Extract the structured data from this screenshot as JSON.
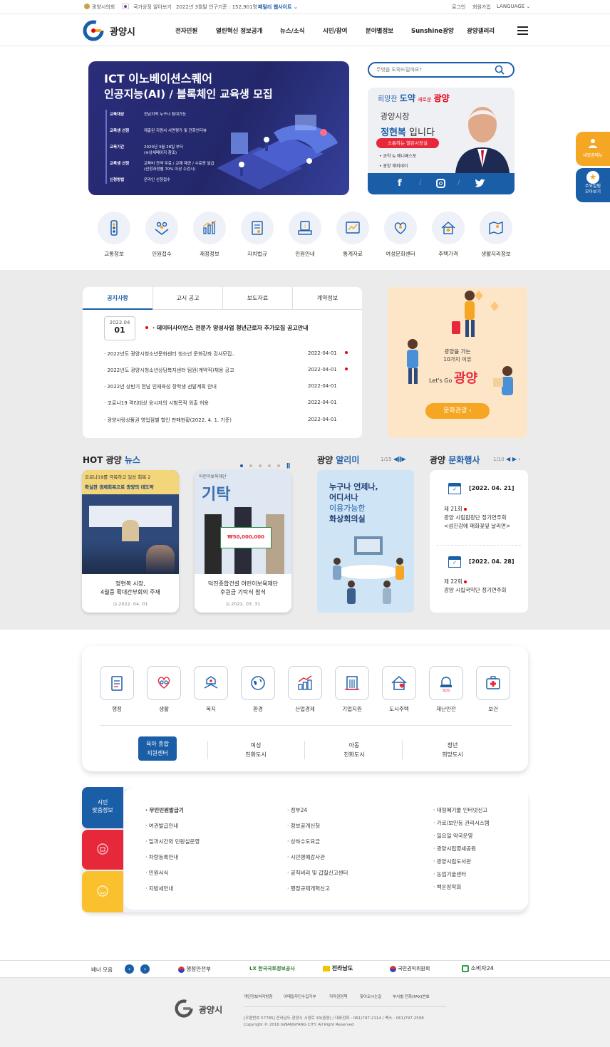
{
  "topbar": {
    "council": "광양시의회",
    "symbol": "국가상징 알아보기",
    "population": "2022년 3월말 인구기준 : 152,901명",
    "family_site": "패밀리 웹사이트",
    "login": "로그인",
    "join": "회원가입",
    "language": "LANGUAGE"
  },
  "header": {
    "logo_text": "광양시",
    "nav": [
      "전자민원",
      "열린혁신 정보공개",
      "뉴스/소식",
      "시민/참여",
      "분야별정보",
      "Sunshine광양",
      "광양갤러리"
    ]
  },
  "banner": {
    "title1": "ICT 이노베이션스퀘어",
    "title2": "인공지능(AI) / 블록체인 교육생 모집",
    "rows": [
      {
        "k": "교육대상",
        "v": "전남지역 누구나 참여가능"
      },
      {
        "k": "교육생 선정",
        "v": "제출된 지원서 서면평가 및 전화인터뷰"
      },
      {
        "k": "교육기간",
        "v": "2020년 3월 28일 부터",
        "v2": "(※상세페이지 참조)"
      },
      {
        "k": "교육생 선정",
        "v": "교육비 전액 무료 / 교재 제공 / 수료증 발급",
        "v2": "(선정과정별 70% 이상 수강시)"
      },
      {
        "k": "신청방법",
        "v": "온라인 신청접수"
      }
    ]
  },
  "search": {
    "placeholder": "무엇을 도와드릴까요?"
  },
  "mayor": {
    "slogan1": "희망찬",
    "slogan2": "도약",
    "slogan3": "새로운",
    "slogan4": "광양",
    "role": "광양시장",
    "name": "정현복",
    "suffix": "입니다",
    "badge": "소통하는 열린시장실",
    "link1": "• 공약 & 매니페스토",
    "link2": "• 광양 해피데이"
  },
  "quick": [
    "교통정보",
    "민원접수",
    "재정정보",
    "자치법규",
    "민원안내",
    "통계자료",
    "여성문화센터",
    "주택가격",
    "생활지리정보"
  ],
  "notice": {
    "tabs": [
      "공지사항",
      "고시 공고",
      "보도자료",
      "계약정보"
    ],
    "feature": {
      "ym": "2022.04",
      "day": "01",
      "title": "· 데이터사이언스 전문가 양성사업 청년근로자 추가모집 공고안내"
    },
    "items": [
      {
        "t": "· 2022년도 광양시청소년문화센터 청소년 문화강좌 강사모집..",
        "d": "2022-04-01",
        "new": true
      },
      {
        "t": "· 2022년도 광양시청소년상담복지센터 팀원(계약직)채용 공고",
        "d": "2022-04-01",
        "new": true
      },
      {
        "t": "· 2022년 상반기 전남 인재육성 장학생 선발계획 안내",
        "d": "2022-04-01",
        "new": false
      },
      {
        "t": "· 코로나19 격리대상 응시자의 시험목적 외출 허용",
        "d": "2022-04-01",
        "new": false
      },
      {
        "t": "· 광양사랑상품권 영업점별 할인 판매현황(2022. 4. 1. 기준)",
        "d": "2022-04-01",
        "new": false
      }
    ]
  },
  "tour": {
    "line1": "광양을 가는",
    "line2": "10가지 이유",
    "lets": "Let's Go",
    "city": "광양",
    "btn": "문화관광 ›"
  },
  "hot": {
    "t1": "HOT 광양 ",
    "t2": "뉴스",
    "img1_line1": "코로나19를 극복하고 일상 회복 2",
    "img1_line2": "확실한 경제회복으로 광양의 대도약",
    "img2_label": "어린이보육재단",
    "img2_big": "기탁",
    "img2_amount": "₩50,000,000",
    "items": [
      {
        "t1": "정현복 시장,",
        "t2": "4월중 확대간부회의 주재",
        "d": "2022. 04. 01"
      },
      {
        "t1": "덕진종합건설 어린이보육재단",
        "t2": "후원금 기탁식 참석",
        "d": "2022. 03. 31"
      }
    ]
  },
  "alimi": {
    "t1": "광양 ",
    "t2": "알리미",
    "page": "1/15",
    "l1": "누구나 언제나,",
    "l2": "어디서나",
    "l3": "이용가능한",
    "l4": "화상회의실"
  },
  "culture": {
    "t1": "광양 ",
    "t2": "문화행사",
    "page": "1/10",
    "events": [
      {
        "date": "[2022. 04. 21]",
        "l1": "제 21회",
        "l2": "광양 시립합창단 정기연주회",
        "l3": "<섬진강에 매화꽃잎 날리면>"
      },
      {
        "date": "[2022. 04. 28]",
        "l1": "제 22회",
        "l2": "광양 시립국악단 정기연주회",
        "l3": ""
      }
    ]
  },
  "categories": [
    "행정",
    "생활",
    "복지",
    "환경",
    "산업경제",
    "기업지원",
    "도시주택",
    "재난안전",
    "보건"
  ],
  "subcats": [
    {
      "l1": "육아 종합",
      "l2": "지원센터"
    },
    {
      "l1": "여성",
      "l2": "친화도시"
    },
    {
      "l1": "아동",
      "l2": "친화도시"
    },
    {
      "l1": "청년",
      "l2": "희망도시"
    }
  ],
  "citizen": {
    "tab1": "시민",
    "tab2": "맞춤정보",
    "col1": [
      "· 무인민원발급기",
      "· 여권발급안내",
      "· 일과시간외 민원실운영",
      "· 차량등록안내",
      "· 민원서식",
      "· 지방세안내"
    ],
    "col2": [
      "· 정부24",
      "· 정보공개신청",
      "· 상하수도요금",
      "· 시민명예감사관",
      "· 공직비리 및 갑질신고센터",
      "· 행정규제개혁신고"
    ],
    "col3": [
      "· 대형폐기물 인터넷신고",
      "· 가로/보안등 관리시스템",
      "· 일요일 약국운영",
      "· 광양시립영세공원",
      "· 광양시립도서관",
      "· 농업기술센터",
      "· 백운장학회"
    ]
  },
  "banners": {
    "label": "배너 모음",
    "items": [
      "행정안전부",
      "LX 한국국토정보공사",
      "전라남도",
      "국민권익위원회",
      "소비자24"
    ]
  },
  "footer": {
    "logo_text": "광양시",
    "links": [
      "개인정보처리방침",
      "이메일무단수집거부",
      "저작권정책",
      "찾아오시는길",
      "부서별 전화(FAX)번호"
    ],
    "addr": "[우편번호 57785] 전라남도 광양시 시청로 33(중동) / 대표전화 : 061)797-2114 / 팩스 : 061)797-2598",
    "copy": "Copyright © 2016 GWANGYANG CITY. All Right Reserved"
  },
  "side": {
    "b1": "내맞춤메뉴",
    "b2a": "주요알림",
    "b2b": "모아보기"
  },
  "colors": {
    "primary": "#1b5ea8",
    "accent_red": "#e60012",
    "orange": "#f5a623",
    "gray_bg": "#ebebeb"
  }
}
